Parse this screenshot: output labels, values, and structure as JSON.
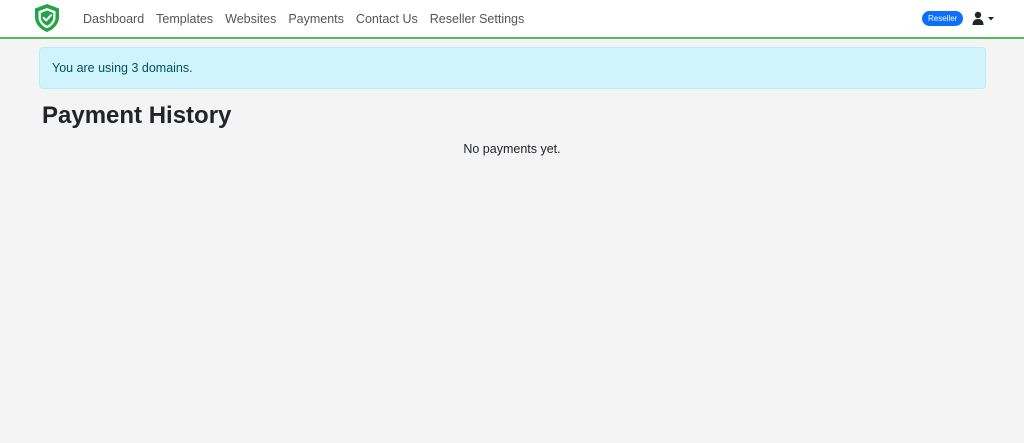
{
  "nav": {
    "logo_icon": "shield-check-icon",
    "links": [
      "Dashboard",
      "Templates",
      "Websites",
      "Payments",
      "Contact Us",
      "Reseller Settings"
    ],
    "badge": "Reseller",
    "user_icon": "user-icon",
    "accent_color": "#5cb85c"
  },
  "alert": {
    "text": "You are using 3 domains."
  },
  "main": {
    "title": "Payment History",
    "empty_message": "No payments yet."
  }
}
